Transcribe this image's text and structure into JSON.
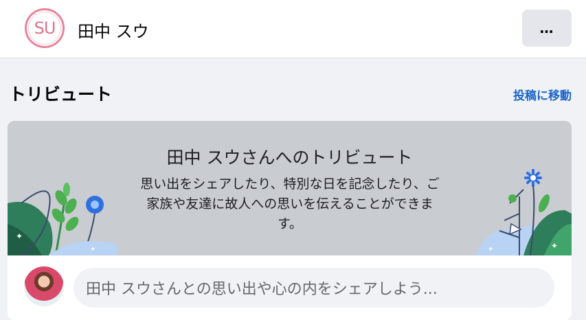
{
  "header": {
    "avatar_initials": "SU",
    "profile_name": "田中 スウ",
    "more_button_label": "…"
  },
  "section": {
    "title": "トリビュート",
    "goto_link": "投稿に移動"
  },
  "banner": {
    "title": "田中 スウさんへのトリビュート",
    "description": "思い出をシェアしたり、特別な日を記念したり、ご家族や友達に故人への思いを伝えることができます。"
  },
  "composer": {
    "placeholder": "田中 スウさんとの思い出や心の内をシェアしよう..."
  },
  "colors": {
    "page_bg": "#f0f2f5",
    "banner_bg": "#c9ccd1",
    "link": "#1b66c9",
    "avatar_ring": "#e9839a"
  }
}
